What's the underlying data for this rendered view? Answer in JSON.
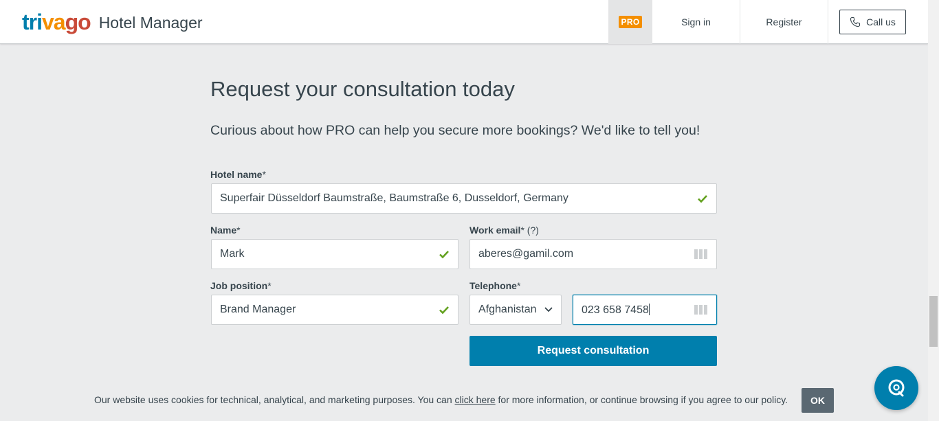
{
  "header": {
    "logo_part1": "tri",
    "logo_part2": "va",
    "logo_part3": "go",
    "logo_suffix": "Hotel Manager",
    "pro_badge": "PRO",
    "signin": "Sign in",
    "register": "Register",
    "call_us": "Call us"
  },
  "page": {
    "title": "Request your consultation today",
    "subtitle": "Curious about how PRO can help you secure more bookings? We'd like to tell you!"
  },
  "form": {
    "hotel_label": "Hotel name",
    "hotel_value": "Superfair Düsseldorf Baumstraße, Baumstraße 6, Dusseldorf, Germany",
    "name_label": "Name",
    "name_value": "Mark",
    "email_label": "Work email",
    "email_hint": "(?)",
    "email_value": "aberes@gamil.com",
    "job_label": "Job position",
    "job_value": "Brand Manager",
    "phone_label": "Telephone",
    "country_value": "Afghanistan",
    "phone_value": "023 658 7458",
    "required_mark": "*",
    "submit_label": "Request consultation"
  },
  "cookie": {
    "text_before": "Our website uses cookies for technical, analytical, and marketing purposes. You can ",
    "link_text": "click here",
    "text_after": " for more information, or continue browsing if you agree to our policy.",
    "ok_label": "OK"
  },
  "colors": {
    "brand_blue": "#007fad",
    "brand_orange": "#f48f00",
    "brand_red": "#c94a38",
    "valid_green": "#63a11f"
  }
}
